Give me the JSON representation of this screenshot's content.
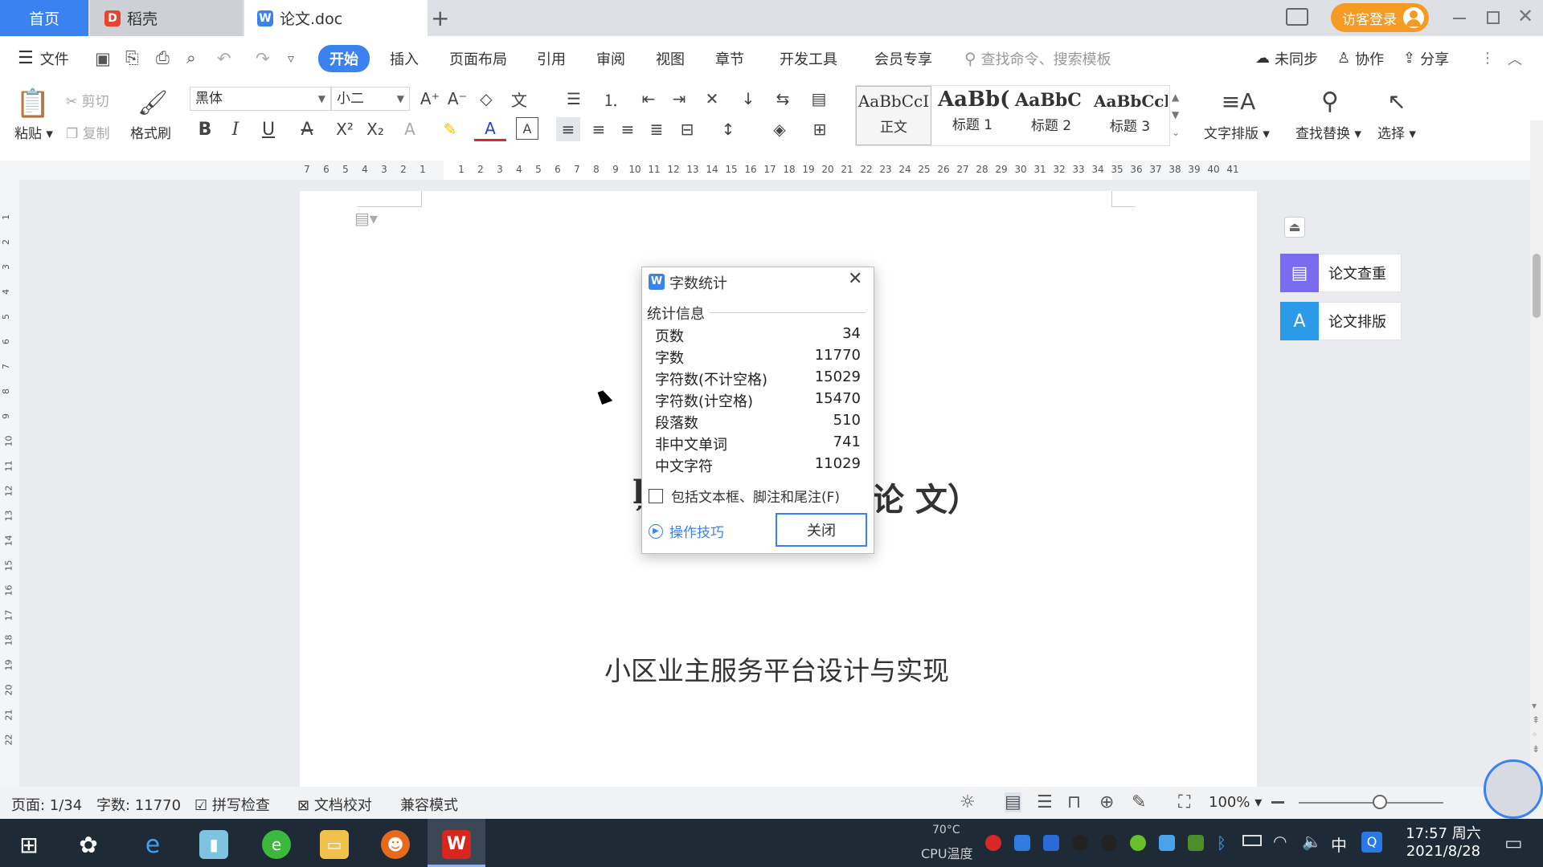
{
  "tabs": {
    "home": "首页",
    "daoke": "稻壳",
    "doc": "论文.doc",
    "new_tab": "+"
  },
  "topright": {
    "login": "访客登录"
  },
  "menu": {
    "file": "文件",
    "items": [
      "开始",
      "插入",
      "页面布局",
      "引用",
      "审阅",
      "视图",
      "章节",
      "开发工具",
      "会员专享"
    ],
    "search_placeholder": "查找命令、搜索模板",
    "sync": "未同步",
    "collab": "协作",
    "share": "分享"
  },
  "ribbon": {
    "paste": "粘贴",
    "cut": "剪切",
    "copy": "复制",
    "format_painter": "格式刷",
    "font_name": "黑体",
    "font_size": "小二",
    "styles": [
      {
        "preview": "AaBbCcI",
        "label": "正文"
      },
      {
        "preview": "AaBb(",
        "label": "标题 1"
      },
      {
        "preview": "AaBbC",
        "label": "标题 2"
      },
      {
        "preview": "AaBbCcl",
        "label": "标题 3"
      }
    ],
    "text_layout": "文字排版",
    "find_replace": "查找替换",
    "select": "选择"
  },
  "ruler": {
    "numbers": [
      "7",
      "6",
      "5",
      "4",
      "3",
      "2",
      "1",
      "",
      "1",
      "2",
      "3",
      "4",
      "5",
      "6",
      "7",
      "8",
      "9",
      "10",
      "11",
      "12",
      "13",
      "14",
      "15",
      "16",
      "17",
      "18",
      "19",
      "20",
      "21",
      "22",
      "23",
      "24",
      "25",
      "26",
      "27",
      "28",
      "29",
      "30",
      "31",
      "32",
      "33",
      "34",
      "35",
      "36",
      "37",
      "38",
      "39",
      "40",
      "41"
    ],
    "vnumbers": [
      "1",
      "2",
      "3",
      "4",
      "5",
      "6",
      "7",
      "8",
      "9",
      "10",
      "11",
      "12",
      "13",
      "14",
      "15",
      "16",
      "17",
      "18",
      "19",
      "20",
      "21",
      "22"
    ]
  },
  "document": {
    "heading_partial_left": "ļ",
    "heading_partial_right": "论 文）",
    "title": "小区业主服务平台设计与实现"
  },
  "side_panel": {
    "check": "论文查重",
    "layout": "论文排版"
  },
  "dialog": {
    "title": "字数统计",
    "section": "统计信息",
    "stats": [
      {
        "label": "页数",
        "value": "34"
      },
      {
        "label": "字数",
        "value": "11770"
      },
      {
        "label": "字符数(不计空格)",
        "value": "15029"
      },
      {
        "label": "字符数(计空格)",
        "value": "15470"
      },
      {
        "label": "段落数",
        "value": "510"
      },
      {
        "label": "非中文单词",
        "value": "741"
      },
      {
        "label": "中文字符",
        "value": "11029"
      }
    ],
    "checkbox_label": "包括文本框、脚注和尾注(F)",
    "tips": "操作技巧",
    "close": "关闭"
  },
  "status": {
    "page": "页面: 1/34",
    "words": "字数: 11770",
    "spell": "拼写检查",
    "proof": "文档校对",
    "compat": "兼容模式",
    "zoom": "100%"
  },
  "taskbar": {
    "cpu_temp": "70°C",
    "cpu_label": "CPU温度",
    "ime": "中",
    "time": "17:57 周六",
    "date": "2021/8/28"
  },
  "colors": {
    "accent": "#3a82f0",
    "login_bg": "#f59b24",
    "wps_red": "#d9261c"
  }
}
